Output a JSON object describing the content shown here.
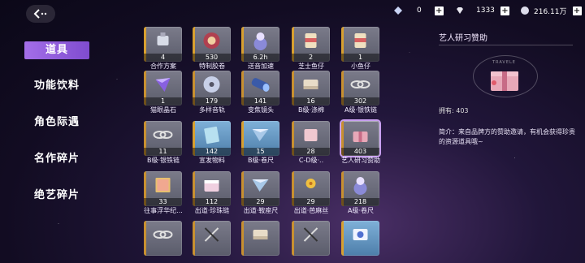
{
  "currencies": [
    {
      "name": "crystal",
      "icon": "crystal-icon",
      "value": "0"
    },
    {
      "name": "diamond",
      "icon": "diamond-icon",
      "value": "1333"
    },
    {
      "name": "coin",
      "icon": "coin-icon",
      "value": "216.11万"
    }
  ],
  "sidebar": {
    "items": [
      {
        "label": "道具",
        "active": true
      },
      {
        "label": "功能饮料",
        "active": false
      },
      {
        "label": "角色际遇",
        "active": false
      },
      {
        "label": "名作碎片",
        "active": false
      },
      {
        "label": "绝艺碎片",
        "active": false
      }
    ]
  },
  "items": [
    {
      "count": "4",
      "name": "合作方案",
      "icon": "usb-icon",
      "rarity": "gold"
    },
    {
      "count": "530",
      "name": "特制胶卷",
      "icon": "film-roll-icon",
      "rarity": "gold"
    },
    {
      "count": "6.2h",
      "name": "送音加速",
      "icon": "figurine-icon",
      "rarity": "gold"
    },
    {
      "count": "2",
      "name": "芝士鱼仔",
      "icon": "snack-bag-icon",
      "rarity": "gold"
    },
    {
      "count": "1",
      "name": "小鱼仔",
      "icon": "snack-bag-icon",
      "rarity": "gold"
    },
    {
      "count": "1",
      "name": "猫眼晶石",
      "icon": "crystal-icon",
      "rarity": "grey"
    },
    {
      "count": "179",
      "name": "多样音轨",
      "icon": "cd-icon",
      "rarity": "grey"
    },
    {
      "count": "141",
      "name": "变焦镜头",
      "icon": "lens-icon",
      "rarity": "grey"
    },
    {
      "count": "16",
      "name": "B级·涤棉",
      "icon": "fabric-icon",
      "rarity": "grey"
    },
    {
      "count": "302",
      "name": "A级·银铁链",
      "icon": "chain-icon",
      "rarity": "grey"
    },
    {
      "count": "11",
      "name": "B级·银铁链",
      "icon": "chain-icon",
      "rarity": "grey"
    },
    {
      "count": "142",
      "name": "宣发物料",
      "icon": "flyer-icon",
      "rarity": "blue"
    },
    {
      "count": "15",
      "name": "B级·卷尺",
      "icon": "ruler-icon",
      "rarity": "blue"
    },
    {
      "count": "28",
      "name": "C-D级·..",
      "icon": "cloth-icon",
      "rarity": "grey"
    },
    {
      "count": "403",
      "name": "艺人研习赞助",
      "icon": "gift-box-icon",
      "rarity": "grey",
      "selected": true
    },
    {
      "count": "33",
      "name": "往事浮华纪...",
      "icon": "book-icon",
      "rarity": "grey"
    },
    {
      "count": "112",
      "name": "出道·珍珠链",
      "icon": "box-icon",
      "rarity": "grey"
    },
    {
      "count": "29",
      "name": "出道·鞍座尺",
      "icon": "ruler-icon",
      "rarity": "grey"
    },
    {
      "count": "29",
      "name": "出道·芭麻丝",
      "icon": "flower-icon",
      "rarity": "grey"
    },
    {
      "count": "218",
      "name": "A级·卷尺",
      "icon": "figurine-icon",
      "rarity": "grey"
    },
    {
      "count": "",
      "name": "",
      "icon": "chain-icon",
      "rarity": "grey"
    },
    {
      "count": "",
      "name": "",
      "icon": "scissors-icon",
      "rarity": "grey"
    },
    {
      "count": "",
      "name": "",
      "icon": "fabric-icon",
      "rarity": "grey"
    },
    {
      "count": "",
      "name": "",
      "icon": "scissors-icon",
      "rarity": "grey"
    },
    {
      "count": "",
      "name": "",
      "icon": "card-icon",
      "rarity": "blue"
    }
  ],
  "detail": {
    "title": "艺人研习赞助",
    "banner_text": "TRAVELE",
    "owned_label": "拥有: 403",
    "description": "简介：来自品牌方的赞助邀请，有机会获得珍贵的资源道具哦~"
  },
  "colors": {
    "accent": "#9b63e6",
    "selected_border": "#c89ff0"
  }
}
